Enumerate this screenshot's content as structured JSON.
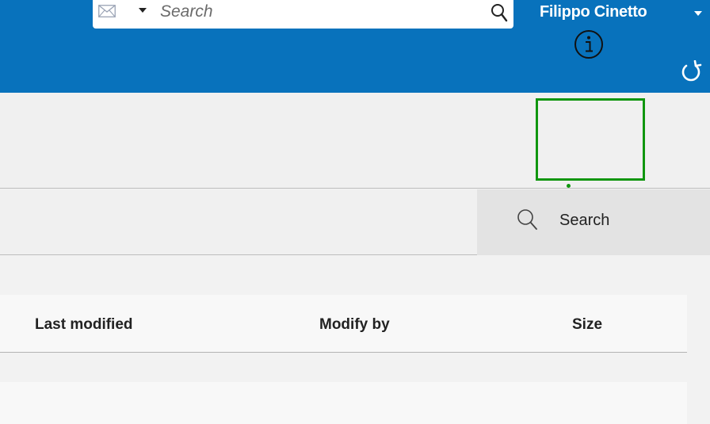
{
  "header": {
    "search": {
      "placeholder": "Search",
      "value": ""
    },
    "user_name": "Filippo Cinetto",
    "icons": {
      "mail": "envelope-icon",
      "caret": "caret-down-icon",
      "search": "magnifier-icon",
      "refresh": "refresh-icon"
    },
    "colors": {
      "bar": "#0872bc"
    }
  },
  "infobar": {
    "icon": "info-icon",
    "highlight_color": "#10960f"
  },
  "toolbar": {
    "search_label": "Search",
    "search_icon": "magnifier-icon"
  },
  "table": {
    "columns": [
      "Last modified",
      "Modify by",
      "Size"
    ],
    "rows": []
  }
}
